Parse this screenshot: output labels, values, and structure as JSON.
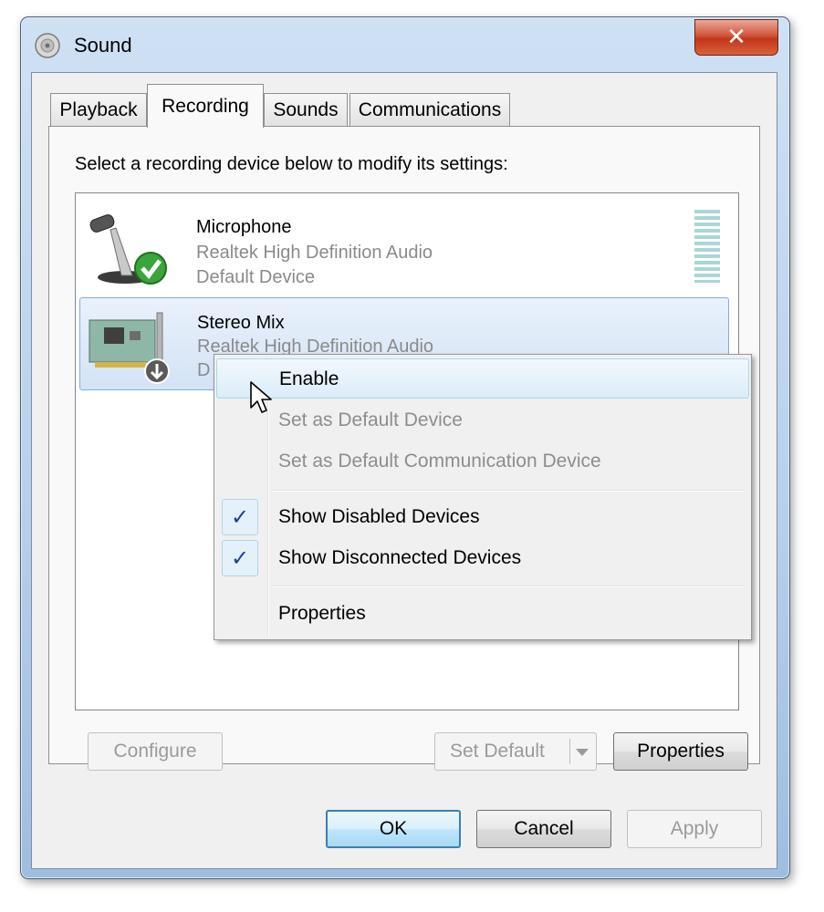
{
  "window": {
    "title": "Sound",
    "close_glyph": "✕"
  },
  "tabs": [
    {
      "label": "Playback"
    },
    {
      "label": "Recording"
    },
    {
      "label": "Sounds"
    },
    {
      "label": "Communications"
    }
  ],
  "active_tab": "Recording",
  "recording": {
    "instruction": "Select a recording device below to modify its settings:",
    "devices": [
      {
        "name": "Microphone",
        "driver": "Realtek High Definition Audio",
        "status": "Default Device",
        "icon": "microphone-icon",
        "badge": "default-check-icon"
      },
      {
        "name": "Stereo Mix",
        "driver": "Realtek High Definition Audio",
        "status": "D",
        "icon": "sound-card-icon",
        "badge": "disabled-arrow-icon"
      }
    ]
  },
  "context_menu": {
    "items": [
      {
        "label": "Enable",
        "enabled": true,
        "checked": false
      },
      {
        "label": "Set as Default Device",
        "enabled": false,
        "checked": false
      },
      {
        "label": "Set as Default Communication Device",
        "enabled": false,
        "checked": false
      },
      {
        "label": "Show Disabled Devices",
        "enabled": true,
        "checked": true
      },
      {
        "label": "Show Disconnected Devices",
        "enabled": true,
        "checked": true
      },
      {
        "label": "Properties",
        "enabled": true,
        "checked": false
      }
    ],
    "check_glyph": "✓"
  },
  "buttons": {
    "configure": "Configure",
    "set_default": "Set Default",
    "properties": "Properties",
    "ok": "OK",
    "cancel": "Cancel",
    "apply": "Apply"
  },
  "colors": {
    "selection": "#d3e3f6",
    "check": "#1e3e9a",
    "close": "#c2351a"
  }
}
